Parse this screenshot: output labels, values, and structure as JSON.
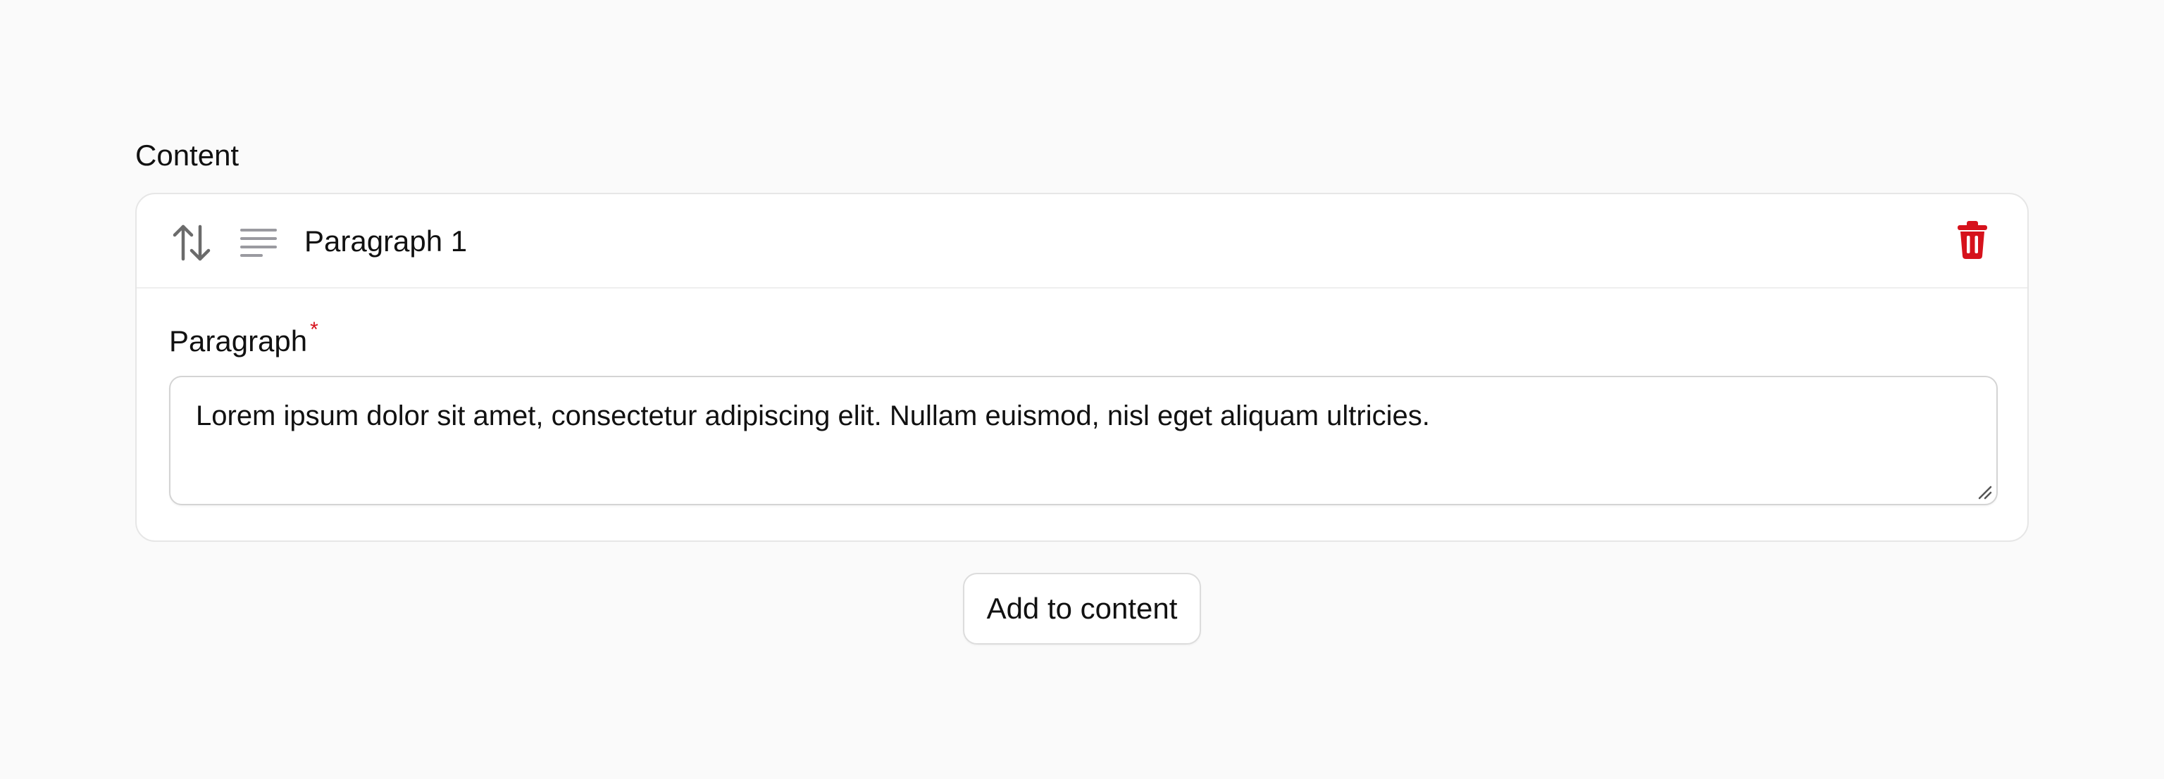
{
  "section": {
    "label": "Content"
  },
  "block": {
    "title": "Paragraph 1",
    "drag_icon": "arrows-up-down-icon",
    "type_icon": "align-left-icon",
    "delete_icon": "trash-icon",
    "field": {
      "label": "Paragraph",
      "required_mark": "*",
      "value": "Lorem ipsum dolor sit amet, consectetur adipiscing elit. Nullam euismod, nisl eget aliquam ultricies."
    }
  },
  "actions": {
    "add_label": "Add to content"
  },
  "colors": {
    "background": "#fafafa",
    "card": "#ffffff",
    "danger": "#d6121c",
    "icon_gray": "#6b6b6b",
    "icon_light": "#9a9aa0"
  }
}
